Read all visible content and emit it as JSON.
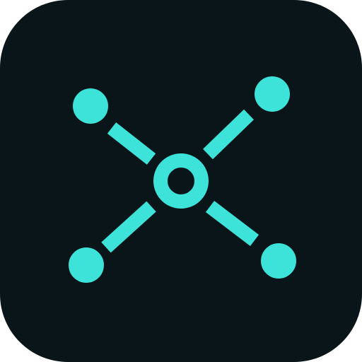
{
  "icon": {
    "name": "network-hub-icon",
    "colors": {
      "background": "#0A151A",
      "accent": "#3DE3D9"
    }
  }
}
